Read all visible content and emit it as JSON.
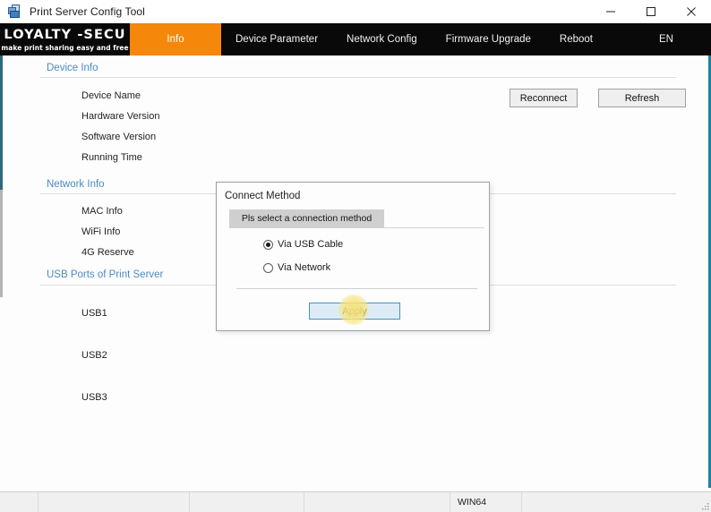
{
  "window": {
    "title": "Print Server Config Tool",
    "icon": "print-server-icon",
    "controls": {
      "minimize": "minimize",
      "maximize": "maximize",
      "close": "close"
    }
  },
  "brand": {
    "name": "LOYALTY -SECU",
    "tagline": "make print sharing easy and free",
    "accent": "#f5870a"
  },
  "nav": {
    "items": [
      {
        "label": "Info",
        "active": true
      },
      {
        "label": "Device Parameter",
        "active": false
      },
      {
        "label": "Network Config",
        "active": false
      },
      {
        "label": "Firmware Upgrade",
        "active": false
      },
      {
        "label": "Reboot",
        "active": false
      }
    ],
    "language": "EN"
  },
  "toolbar": {
    "reconnect_label": "Reconnect",
    "refresh_label": "Refresh"
  },
  "sections": {
    "device_info": {
      "title": "Device Info",
      "rows": [
        {
          "label": "Device Name",
          "value": ""
        },
        {
          "label": "Hardware Version",
          "value": ""
        },
        {
          "label": "Software Version",
          "value": ""
        },
        {
          "label": "Running Time",
          "value": ""
        }
      ]
    },
    "network_info": {
      "title": "Network Info",
      "rows": [
        {
          "label": "MAC Info",
          "value": ""
        },
        {
          "label": "WiFi Info",
          "value": ""
        },
        {
          "label": "4G Reserve",
          "value": ""
        }
      ]
    },
    "usb_ports": {
      "title": "USB Ports of Print Server",
      "rows": [
        {
          "label": "USB1",
          "value": ""
        },
        {
          "label": "USB2",
          "value": ""
        },
        {
          "label": "USB3",
          "value": ""
        }
      ]
    }
  },
  "dialog": {
    "title": "Connect Method",
    "prompt": "Pls select a connection method",
    "options": [
      {
        "label": "Via USB Cable",
        "selected": true
      },
      {
        "label": "Via Network",
        "selected": false
      }
    ],
    "apply_label": "Apply"
  },
  "statusbar": {
    "cells": [
      "",
      "",
      "",
      "",
      "WIN64",
      ""
    ]
  }
}
